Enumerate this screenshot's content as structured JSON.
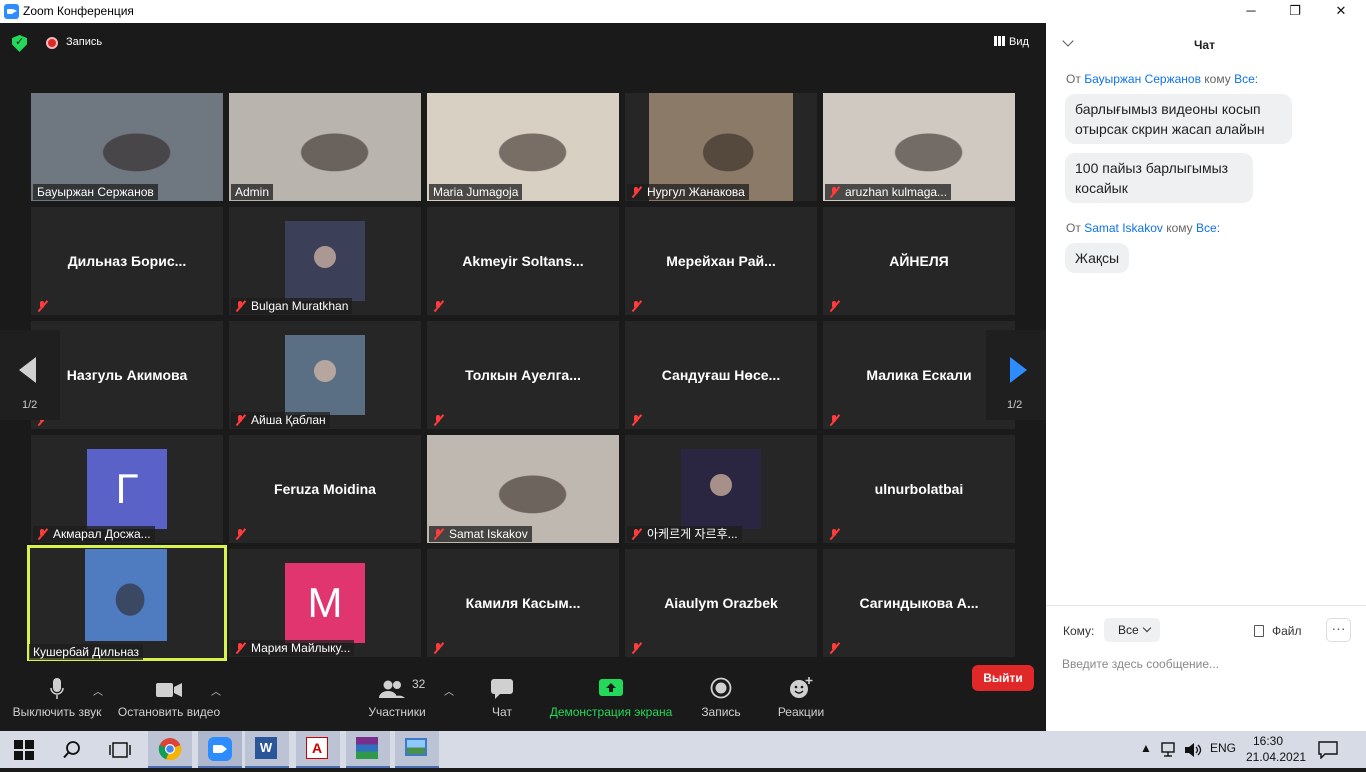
{
  "window": {
    "title": "Zoom Конференция",
    "min": "─",
    "max": "❐",
    "close": "✕"
  },
  "topbar": {
    "record_label": "Запись",
    "view_label": "Вид"
  },
  "tiles": [
    {
      "name": "Бауыржан Серж​анов",
      "type": "video",
      "muted": false,
      "bg": "#6f7780"
    },
    {
      "name": "Admin",
      "type": "video",
      "muted": false,
      "bg": "#b9b4ae"
    },
    {
      "name": "Maria Jumagoja",
      "type": "video",
      "muted": false,
      "bg": "#d8d0c3"
    },
    {
      "name": "Нургул Жанакова",
      "type": "video",
      "muted": true,
      "bg": "#8c7a68"
    },
    {
      "name": "aruzhan kulmaga...",
      "type": "video",
      "muted": true,
      "bg": "#cfc9c2"
    },
    {
      "name": "Дильназ  Борис...",
      "type": "name",
      "muted": true
    },
    {
      "name": "Bulgan Muratkhan",
      "type": "photo",
      "muted": true,
      "bg": "#3b3f58"
    },
    {
      "name": "Akmeyir  Soltans...",
      "type": "name",
      "muted": true
    },
    {
      "name": "Мерейхан  Рай...",
      "type": "name",
      "muted": true
    },
    {
      "name": "АЙНЕЛЯ",
      "type": "name",
      "muted": true
    },
    {
      "name": "Назгуль Акимова",
      "type": "name",
      "muted": true
    },
    {
      "name": "Айша Қаблан",
      "type": "photo",
      "muted": true,
      "bg": "#5b6f84"
    },
    {
      "name": "Толкын  Ауелга...",
      "type": "name",
      "muted": true
    },
    {
      "name": "Сандуғаш  Нөсе...",
      "type": "name",
      "muted": true
    },
    {
      "name": "Малика Ескали",
      "type": "name",
      "muted": true
    },
    {
      "name": "Акмарал Досжа...",
      "type": "letter",
      "letter": "Г",
      "muted": true,
      "bg": "#5a62c7"
    },
    {
      "name": "Feruza Moidina",
      "type": "name",
      "muted": true
    },
    {
      "name": "Samat Iskakov",
      "type": "video",
      "muted": true,
      "bg": "#bfb8b0"
    },
    {
      "name": "아케르게 자르후...",
      "type": "photo",
      "muted": true,
      "bg": "#2a2540"
    },
    {
      "name": "ulnurbolatbai",
      "type": "name",
      "muted": true
    },
    {
      "name": "Кушербай Дильназ",
      "type": "video",
      "muted": false,
      "bg": "#4f7bc0",
      "active": true
    },
    {
      "name": "Мария Майлыку...",
      "type": "letter",
      "letter": "M",
      "muted": true,
      "bg": "#e0356f"
    },
    {
      "name": "Камиля  Касым...",
      "type": "name",
      "muted": true
    },
    {
      "name": "Aiaulym Orazbek",
      "type": "name",
      "muted": true
    },
    {
      "name": "Сагиндыкова  А...",
      "type": "name",
      "muted": true
    }
  ],
  "pager": {
    "left": "1/2",
    "right": "1/2"
  },
  "toolbar": {
    "mute": "Выключить звук",
    "video": "Остановить видео",
    "participants": "Участники",
    "participants_count": "32",
    "chat": "Чат",
    "share": "Демонстрация экрана",
    "record": "Запись",
    "reactions": "Реакции",
    "leave": "Выйти"
  },
  "chat": {
    "title": "Чат",
    "messages": [
      {
        "from_prefix": "От",
        "from": "Бауыржан Серж​анов",
        "to_prefix": "кому",
        "to": "Все:",
        "lines": [
          "барлығымыз видеоны косып отырсак скрин жасап алайын",
          "100 пайыз барлыгымыз косайык"
        ]
      },
      {
        "from_prefix": "От",
        "from": "Samat Iskakov",
        "to_prefix": "кому",
        "to": "Все:",
        "lines": [
          "Жақсы"
        ]
      }
    ],
    "to_label": "Кому:",
    "to_value": "Все",
    "file_label": "Файл",
    "more": "···",
    "placeholder": "Введите здесь сообщение..."
  },
  "taskbar": {
    "lang": "ENG",
    "time": "16:30",
    "date": "21.04.2021"
  }
}
